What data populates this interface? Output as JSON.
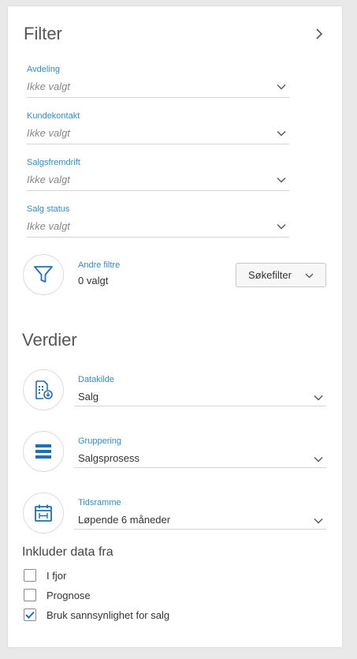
{
  "filter": {
    "title": "Filter",
    "fields": [
      {
        "label": "Avdeling",
        "value": "Ikke valgt"
      },
      {
        "label": "Kundekontakt",
        "value": "Ikke valgt"
      },
      {
        "label": "Salgsfremdrift",
        "value": "Ikke valgt"
      },
      {
        "label": "Salg status",
        "value": "Ikke valgt"
      }
    ],
    "other_filters": {
      "label": "Andre filtre",
      "value": "0 valgt"
    },
    "search_filter_button": "Søkefilter"
  },
  "values": {
    "title": "Verdier",
    "datasource": {
      "label": "Datakilde",
      "value": "Salg"
    },
    "grouping": {
      "label": "Gruppering",
      "value": "Salgsprosess"
    },
    "timeframe": {
      "label": "Tidsramme",
      "value": "Løpende 6 måneder"
    }
  },
  "include": {
    "title": "Inkluder data fra",
    "options": [
      {
        "label": "I fjor",
        "checked": false
      },
      {
        "label": "Prognose",
        "checked": false
      },
      {
        "label": "Bruk sannsynlighet for salg",
        "checked": true
      }
    ]
  },
  "colors": {
    "accent": "#2f8ecc",
    "icon_blue": "#1e6fb5",
    "border": "#d4d4d4"
  }
}
